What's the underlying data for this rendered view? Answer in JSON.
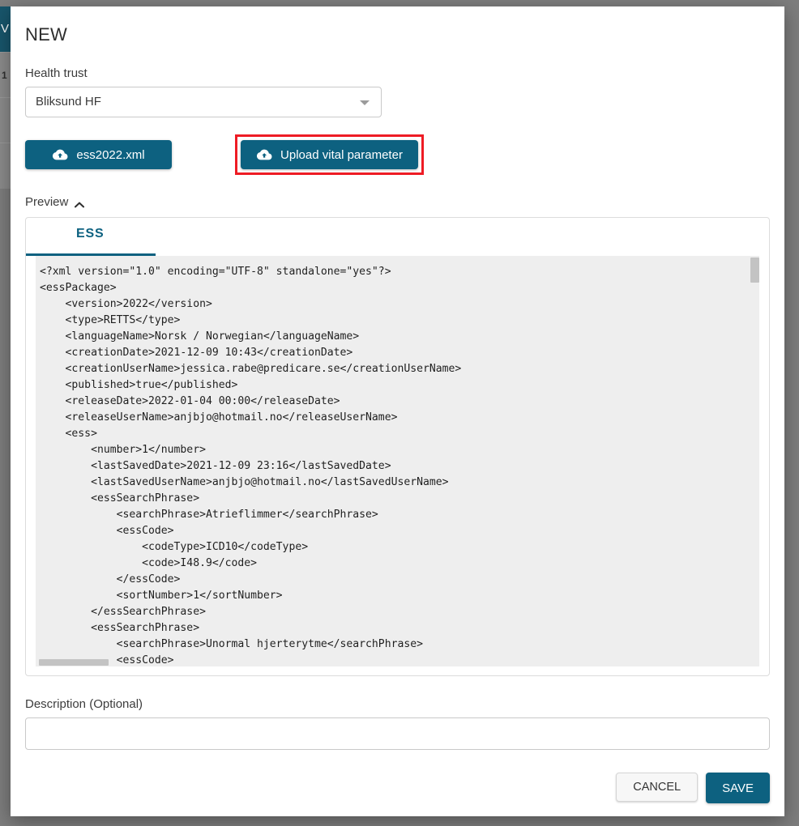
{
  "background": {
    "nav_glyph": "V",
    "rows": [
      "1",
      "",
      ""
    ]
  },
  "dialog": {
    "title": "NEW",
    "health_trust": {
      "label": "Health trust",
      "selected": "Bliksund HF",
      "arrow_icon": "chevron-down-icon"
    },
    "buttons": {
      "file_label": "ess2022.xml",
      "file_icon": "cloud-upload-icon",
      "vital_label": "Upload vital parameter",
      "vital_icon": "cloud-upload-icon",
      "highlight_color": "#ee1b24"
    },
    "preview": {
      "label": "Preview",
      "toggle_icon": "chevron-up-icon",
      "tab_label": "ESS",
      "accent_color": "#0d6180",
      "code": "<?xml version=\"1.0\" encoding=\"UTF-8\" standalone=\"yes\"?>\n<essPackage>\n    <version>2022</version>\n    <type>RETTS</type>\n    <languageName>Norsk / Norwegian</languageName>\n    <creationDate>2021-12-09 10:43</creationDate>\n    <creationUserName>jessica.rabe@predicare.se</creationUserName>\n    <published>true</published>\n    <releaseDate>2022-01-04 00:00</releaseDate>\n    <releaseUserName>anjbjo@hotmail.no</releaseUserName>\n    <ess>\n        <number>1</number>\n        <lastSavedDate>2021-12-09 23:16</lastSavedDate>\n        <lastSavedUserName>anjbjo@hotmail.no</lastSavedUserName>\n        <essSearchPhrase>\n            <searchPhrase>Atrieflimmer</searchPhrase>\n            <essCode>\n                <codeType>ICD10</codeType>\n                <code>I48.9</code>\n            </essCode>\n            <sortNumber>1</sortNumber>\n        </essSearchPhrase>\n        <essSearchPhrase>\n            <searchPhrase>Unormal hjerterytme</searchPhrase>\n            <essCode>"
    },
    "description": {
      "label": "Description (Optional)",
      "value": "",
      "placeholder": ""
    },
    "footer": {
      "cancel_label": "CANCEL",
      "save_label": "SAVE"
    }
  }
}
